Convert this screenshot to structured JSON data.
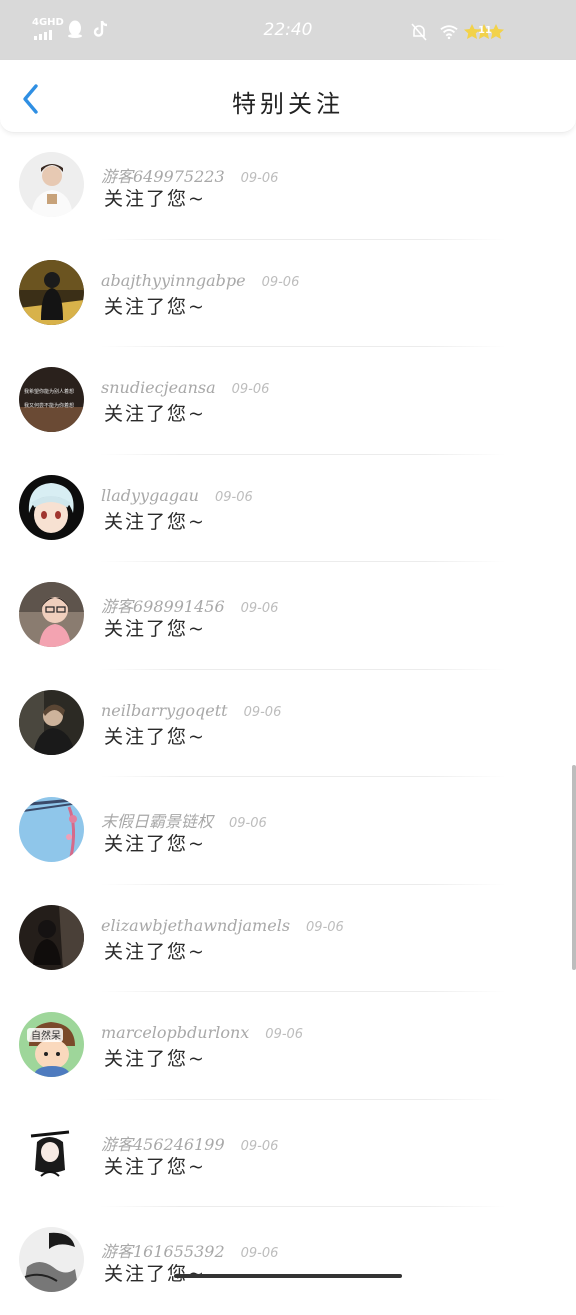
{
  "status_bar": {
    "time": "22:40",
    "network": "4GHD",
    "battery": "11"
  },
  "header": {
    "title": "特别关注"
  },
  "notifications": [
    {
      "username": "游客649975223",
      "date": "09-06",
      "message": "关注了您~",
      "avatar": "man-white"
    },
    {
      "username": "abajthyyinngabpe",
      "date": "09-06",
      "message": "关注了您~",
      "avatar": "girl-night"
    },
    {
      "username": "snudiecjeansa",
      "date": "09-06",
      "message": "关注了您~",
      "avatar": "text-dark"
    },
    {
      "username": "lladyygagau",
      "date": "09-06",
      "message": "关注了您~",
      "avatar": "anime-white-hair"
    },
    {
      "username": "游客698991456",
      "date": "09-06",
      "message": "关注了您~",
      "avatar": "child-glasses"
    },
    {
      "username": "neilbarrygoqett",
      "date": "09-06",
      "message": "关注了您~",
      "avatar": "man-dark"
    },
    {
      "username": "末假日霸景链权",
      "date": "09-06",
      "message": "关注了您~",
      "avatar": "sky-blue"
    },
    {
      "username": "elizawbjethawndjamels",
      "date": "09-06",
      "message": "关注了您~",
      "avatar": "dark-figure"
    },
    {
      "username": "marcelopbdurlonx",
      "date": "09-06",
      "message": "关注了您~",
      "avatar": "cartoon-boy"
    },
    {
      "username": "游客456246199",
      "date": "09-06",
      "message": "关注了您~",
      "avatar": "ink-girl"
    },
    {
      "username": "游客161655392",
      "date": "09-06",
      "message": "关注了您~",
      "avatar": "ink-sketch"
    }
  ],
  "avatar_text": {
    "text_dark_line1": "我希望你能为别人着想",
    "text_dark_line2": "我又何尝不能为你着想",
    "cartoon_badge": "自然呆"
  },
  "colors": {
    "status_bar_bg": "#d9d9d9",
    "back_arrow": "#2f8fe3",
    "username": "#a8a8a8",
    "date": "#bdbdbd",
    "message": "#2a2a2a"
  }
}
